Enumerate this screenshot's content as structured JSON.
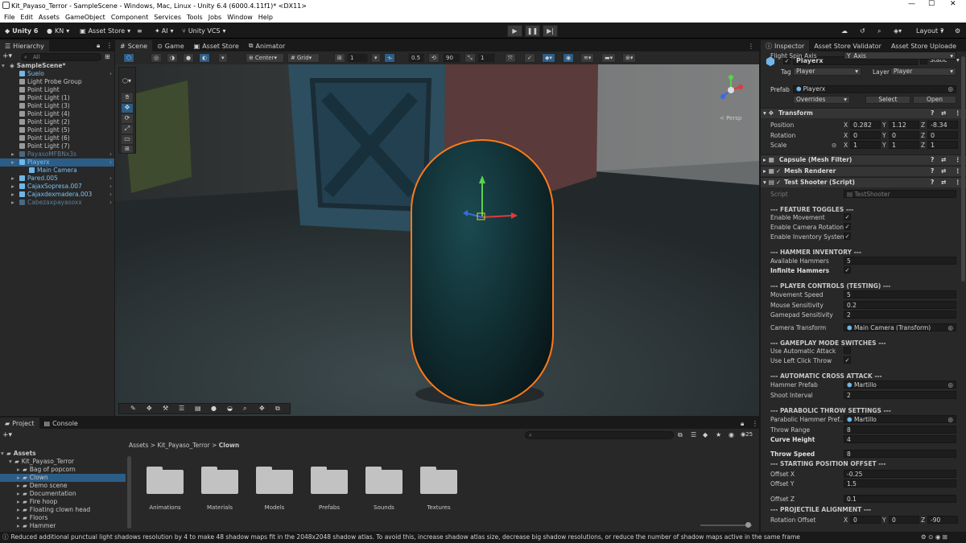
{
  "title_bar": {
    "text": "Kit_Payaso_Terror - SampleScene - Windows, Mac, Linux - Unity 6.4 (6000.4.11f1)* <DX11>"
  },
  "menu": [
    "File",
    "Edit",
    "Assets",
    "GameObject",
    "Component",
    "Services",
    "Tools",
    "Jobs",
    "Window",
    "Help"
  ],
  "toolbar": {
    "unity": "Unity 6",
    "account": "KN",
    "asset_store": "Asset Store",
    "ai": "AI",
    "vcs": "Unity VCS",
    "layout": "Layout"
  },
  "hierarchy": {
    "tab": "Hierarchy",
    "search_placeholder": "All",
    "items": [
      {
        "label": "SampleScene*",
        "indent": 0,
        "kind": "scene"
      },
      {
        "label": "Suelo",
        "indent": 1,
        "kind": "prefab"
      },
      {
        "label": "Light Probe Group",
        "indent": 1,
        "kind": "go"
      },
      {
        "label": "Point Light",
        "indent": 1,
        "kind": "go"
      },
      {
        "label": "Point Light (1)",
        "indent": 1,
        "kind": "go"
      },
      {
        "label": "Point Light (3)",
        "indent": 1,
        "kind": "go"
      },
      {
        "label": "Point Light (4)",
        "indent": 1,
        "kind": "go"
      },
      {
        "label": "Point Light (2)",
        "indent": 1,
        "kind": "go"
      },
      {
        "label": "Point Light (5)",
        "indent": 1,
        "kind": "go"
      },
      {
        "label": "Point Light (6)",
        "indent": 1,
        "kind": "go"
      },
      {
        "label": "Point Light (7)",
        "indent": 1,
        "kind": "go"
      },
      {
        "label": "PayasoMFBNx3s",
        "indent": 1,
        "kind": "disabled"
      },
      {
        "label": "Playerx",
        "indent": 1,
        "kind": "selected"
      },
      {
        "label": "Main Camera",
        "indent": 2,
        "kind": "prefab"
      },
      {
        "label": "Pared.005",
        "indent": 1,
        "kind": "prefab"
      },
      {
        "label": "CajaxSopresa.007",
        "indent": 1,
        "kind": "prefab"
      },
      {
        "label": "Cajaxdexmadera.003",
        "indent": 1,
        "kind": "prefab"
      },
      {
        "label": "Cabezaxpayasoxx",
        "indent": 1,
        "kind": "disabled"
      }
    ]
  },
  "scene": {
    "tabs": [
      "Scene",
      "Game",
      "Asset Store",
      "Animator"
    ],
    "pivot": "Center",
    "grid": "Grid",
    "grid_value": "1",
    "snap_value": "0.5",
    "angle": "90",
    "scale": "1",
    "persp": "< Persp"
  },
  "project": {
    "tabs": [
      "Project",
      "Console"
    ],
    "breadcrumb": [
      "Assets",
      "Kit_Payaso_Terror",
      "Clown"
    ],
    "count": "25",
    "tree": [
      {
        "label": "Assets",
        "indent": 0
      },
      {
        "label": "Kit_Payaso_Terror",
        "indent": 1
      },
      {
        "label": "Bag of popcorn",
        "indent": 2
      },
      {
        "label": "Clown",
        "indent": 2,
        "sel": true
      },
      {
        "label": "Demo scene",
        "indent": 2
      },
      {
        "label": "Documentation",
        "indent": 2
      },
      {
        "label": "Fire hoop",
        "indent": 2
      },
      {
        "label": "Floating clown head",
        "indent": 2
      },
      {
        "label": "Floors",
        "indent": 2
      },
      {
        "label": "Hammer",
        "indent": 2
      }
    ],
    "folders": [
      "Animations",
      "Materials",
      "Models",
      "Prefabs",
      "Sounds",
      "Textures"
    ]
  },
  "status": "Reduced additional punctual light shadows resolution by 4 to make 48 shadow maps fit in the 2048x2048 shadow atlas. To avoid this, increase shadow atlas size, decrease big shadow resolutions, or reduce the number of shadow maps active in the same frame",
  "inspector": {
    "tabs": [
      "Inspector",
      "Asset Store Validator",
      "Asset Store Uploade"
    ],
    "name": "Playerx",
    "static": "Static",
    "tag_label": "Tag",
    "tag": "Player",
    "layer_label": "Layer",
    "layer": "Player",
    "prefab_label": "Prefab",
    "prefab": "Playerx",
    "overrides": "Overrides",
    "select": "Select",
    "open": "Open",
    "transform": {
      "title": "Transform",
      "position": [
        "0.282",
        "1.12",
        "-8.34"
      ],
      "rotation": [
        "0",
        "0",
        "0"
      ],
      "scale": [
        "1",
        "1",
        "1"
      ],
      "pos_label": "Position",
      "rot_label": "Rotation",
      "scale_label": "Scale"
    },
    "components": [
      "Capsule (Mesh Filter)",
      "Mesh Renderer",
      "Test Shooter (Script)"
    ],
    "script_label": "Script",
    "script": "TestShooter",
    "fields": [
      {
        "t": "section",
        "label": "--- FEATURE TOGGLES ---"
      },
      {
        "t": "check",
        "label": "Enable Movement"
      },
      {
        "t": "check",
        "label": "Enable Camera Rotation"
      },
      {
        "t": "check",
        "label": "Enable Inventory System"
      },
      {
        "t": "section",
        "label": "--- HAMMER INVENTORY ---"
      },
      {
        "t": "text",
        "label": "Available Hammers",
        "value": "5"
      },
      {
        "t": "check",
        "label": "Infinite Hammers",
        "bold": true
      },
      {
        "t": "section",
        "label": "--- PLAYER CONTROLS (TESTING) ---"
      },
      {
        "t": "text",
        "label": "Movement Speed",
        "value": "5"
      },
      {
        "t": "text",
        "label": "Mouse Sensitivity",
        "value": "0.2"
      },
      {
        "t": "text",
        "label": "Gamepad Sensitivity",
        "value": "2"
      },
      {
        "t": "ref",
        "label": "Camera Transform",
        "value": "Main Camera (Transform)"
      },
      {
        "t": "section",
        "label": "--- GAMEPLAY MODE SWITCHES ---"
      },
      {
        "t": "uncheck",
        "label": "Use Automatic Attack"
      },
      {
        "t": "check",
        "label": "Use Left Click Throw"
      },
      {
        "t": "section",
        "label": "--- AUTOMATIC CROSS ATTACK ---"
      },
      {
        "t": "ref",
        "label": "Hammer Prefab",
        "value": "Martillo"
      },
      {
        "t": "text",
        "label": "Shoot Interval",
        "value": "2"
      },
      {
        "t": "section",
        "label": "--- PARABOLIC THROW SETTINGS ---"
      },
      {
        "t": "ref",
        "label": "Parabolic Hammer Pref...",
        "value": "Martillo"
      },
      {
        "t": "text",
        "label": "Throw Range",
        "value": "8"
      },
      {
        "t": "text",
        "label": "Curve Height",
        "value": "4",
        "bold": true
      },
      {
        "t": "text",
        "label": "Throw Speed",
        "value": "8",
        "bold": true
      },
      {
        "t": "section",
        "label": "--- STARTING POSITION OFFSET ---"
      },
      {
        "t": "text",
        "label": "Offset X",
        "value": "-0.25"
      },
      {
        "t": "text",
        "label": "Offset Y",
        "value": "1.5"
      },
      {
        "t": "text",
        "label": "Offset Z",
        "value": "0.1"
      },
      {
        "t": "section",
        "label": "--- PROJECTILE ALIGNMENT ---"
      },
      {
        "t": "vec",
        "label": "Rotation Offset",
        "values": [
          "0",
          "0",
          "-90"
        ]
      },
      {
        "t": "drop",
        "label": "Flight Spin Axis",
        "value": "Y_Axis"
      }
    ]
  },
  "colors": {
    "selection": "#2c5d87",
    "capsule_outline": "#ff7a1a",
    "capsule_fill": "#0f2a2e",
    "prefab_blue": "#6fb7e8"
  }
}
